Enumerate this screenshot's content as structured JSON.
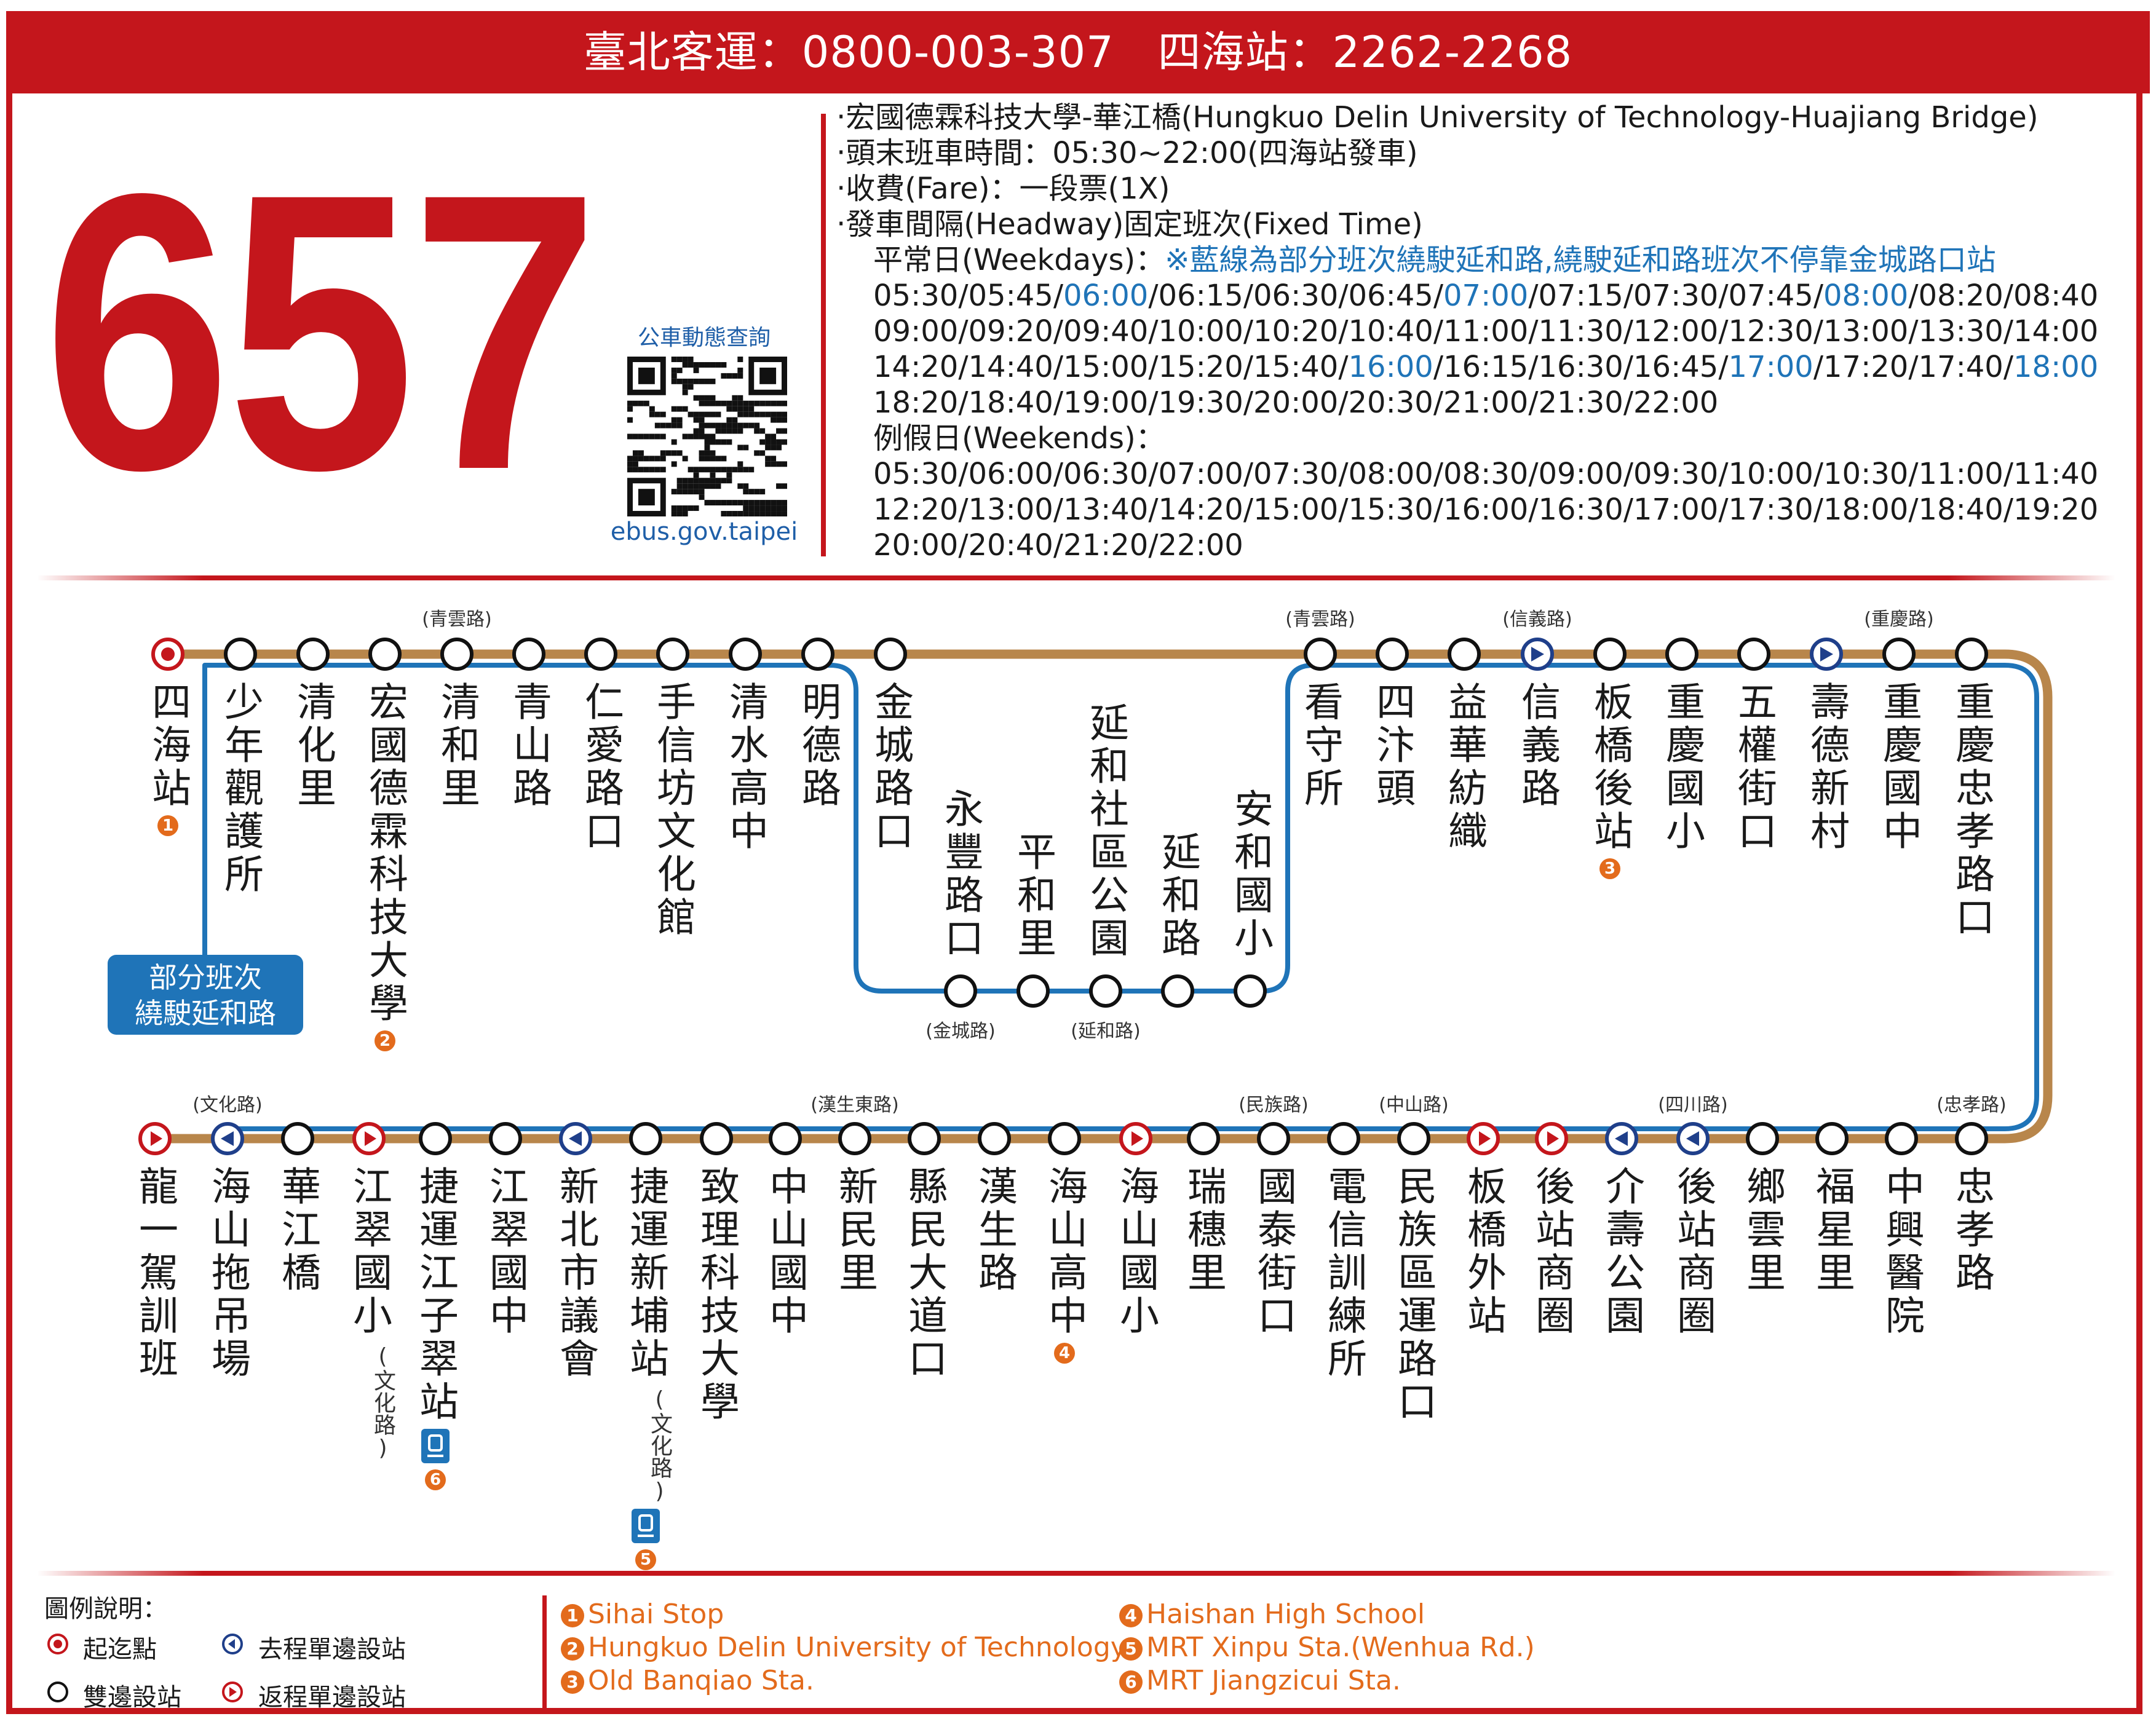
{
  "header": {
    "text": "臺北客運：0800-003-307　四海站：2262-2268"
  },
  "route": {
    "number": "657"
  },
  "qr": {
    "caption": "公車動態查詢",
    "url": "ebus.gov.taipei"
  },
  "info": {
    "line1": "‧宏國德霖科技大學-華江橋(Hungkuo Delin University of Technology-Huajiang Bridge)",
    "line2": "‧頭末班車時間：05:30~22:00(四海站發車)",
    "line3": "‧收費(Fare)：一段票(1X)",
    "line4": "‧發車間隔(Headway)固定班次(Fixed Time)",
    "weekday_label": "平常日(Weekdays)：",
    "weekday_note": "※藍線為部分班次繞駛延和路,繞駛延和路班次不停靠金城路口站",
    "weekday_times": [
      [
        [
          "05:30/05:45/",
          ""
        ],
        [
          "06:00",
          "blue"
        ],
        [
          "/06:15/06:30/06:45/",
          ""
        ],
        [
          "07:00",
          "blue"
        ],
        [
          "/07:15/07:30/07:45/",
          ""
        ],
        [
          "08:00",
          "blue"
        ],
        [
          "/08:20/08:40",
          ""
        ]
      ],
      [
        [
          "09:00/09:20/09:40/10:00/10:20/10:40/11:00/11:30/12:00/12:30/13:00/13:30/14:00",
          ""
        ]
      ],
      [
        [
          "14:20/14:40/15:00/15:20/15:40/",
          ""
        ],
        [
          "16:00",
          "blue"
        ],
        [
          "/16:15/16:30/16:45/",
          ""
        ],
        [
          "17:00",
          "blue"
        ],
        [
          "/17:20/17:40/",
          ""
        ],
        [
          "18:00",
          "blue"
        ]
      ],
      [
        [
          "18:20/18:40/19:00/19:30/20:00/20:30/21:00/21:30/22:00",
          ""
        ]
      ]
    ],
    "weekend_label": "例假日(Weekends)：",
    "weekend_times": [
      "05:30/06:00/06:30/07:00/07:30/08:00/08:30/09:00/09:30/10:00/10:30/11:00/11:40",
      "12:20/13:00/13:40/14:20/15:00/15:30/16:00/16:30/17:00/17:30/18:00/18:40/19:20",
      "20:00/20:40/21:20/22:00"
    ]
  },
  "colors": {
    "red": "#c4161c",
    "brown": "#b8864b",
    "blue": "#1f74b8",
    "orange": "#e36b1c"
  },
  "map": {
    "partial_note": "部分班次\n繞駛延和路",
    "top_stops": [
      {
        "name": "四海站",
        "type": "terminal",
        "badge": "1"
      },
      {
        "name": "少年觀護所",
        "type": "both"
      },
      {
        "name": "清化里",
        "type": "both"
      },
      {
        "name": "宏國德霖科技大學",
        "type": "both",
        "badge": "2"
      },
      {
        "name": "清和里",
        "type": "both",
        "road": "(青雲路)"
      },
      {
        "name": "青山路",
        "type": "both"
      },
      {
        "name": "仁愛路口",
        "type": "both"
      },
      {
        "name": "手信坊文化館",
        "type": "both"
      },
      {
        "name": "清水高中",
        "type": "both"
      },
      {
        "name": "明德路",
        "type": "both"
      },
      {
        "name": "金城路口",
        "type": "both"
      },
      {
        "name": "看守所",
        "type": "both",
        "road": "(青雲路)"
      },
      {
        "name": "四汴頭",
        "type": "both"
      },
      {
        "name": "益華紡織",
        "type": "both"
      },
      {
        "name": "信義路",
        "type": "outbound",
        "road": "(信義路)"
      },
      {
        "name": "板橋後站",
        "type": "both",
        "badge": "3"
      },
      {
        "name": "重慶國小",
        "type": "both"
      },
      {
        "name": "五權街口",
        "type": "both"
      },
      {
        "name": "壽德新村",
        "type": "outbound"
      },
      {
        "name": "重慶國中",
        "type": "both",
        "road": "(重慶路)"
      },
      {
        "name": "重慶忠孝路口",
        "type": "both"
      }
    ],
    "branch_stops": [
      {
        "name": "永豐路口",
        "type": "both",
        "road": "(金城路)"
      },
      {
        "name": "平和里",
        "type": "both"
      },
      {
        "name": "延和社區公園",
        "type": "both",
        "road": "(延和路)"
      },
      {
        "name": "延和路",
        "type": "both"
      },
      {
        "name": "安和國小",
        "type": "both"
      }
    ],
    "bottom_stops": [
      {
        "name": "龍一駕訓班",
        "type": "terminal_return"
      },
      {
        "name": "海山拖吊場",
        "type": "outbound",
        "road": "(文化路)"
      },
      {
        "name": "華江橋",
        "type": "both"
      },
      {
        "name": "江翠國小",
        "type": "return",
        "sub": "(文化路)"
      },
      {
        "name": "捷運江子翠站",
        "type": "both",
        "badge": "6",
        "metro": true
      },
      {
        "name": "江翠國中",
        "type": "both"
      },
      {
        "name": "新北市議會",
        "type": "outbound"
      },
      {
        "name": "捷運新埔站",
        "type": "both",
        "badge": "5",
        "metro": true,
        "sub": "(文化路)"
      },
      {
        "name": "致理科技大學",
        "type": "both"
      },
      {
        "name": "中山國中",
        "type": "both"
      },
      {
        "name": "新民里",
        "type": "both",
        "road": "(漢生東路)"
      },
      {
        "name": "縣民大道口",
        "type": "both"
      },
      {
        "name": "漢生路",
        "type": "both"
      },
      {
        "name": "海山高中",
        "type": "both",
        "badge": "4"
      },
      {
        "name": "海山國小",
        "type": "return"
      },
      {
        "name": "瑞穗里",
        "type": "both"
      },
      {
        "name": "國泰街口",
        "type": "both",
        "road": "(民族路)"
      },
      {
        "name": "電信訓練所",
        "type": "both"
      },
      {
        "name": "民族區運路口",
        "type": "both",
        "road": "(中山路)"
      },
      {
        "name": "板橋外站",
        "type": "return"
      },
      {
        "name": "後站商圈",
        "type": "return"
      },
      {
        "name": "介壽公園",
        "type": "outbound"
      },
      {
        "name": "後站商圈",
        "type": "outbound",
        "road": "(四川路)"
      },
      {
        "name": "鄉雲里",
        "type": "both"
      },
      {
        "name": "福星里",
        "type": "both"
      },
      {
        "name": "中興醫院",
        "type": "both"
      },
      {
        "name": "忠孝路",
        "type": "both",
        "road": "(忠孝路)"
      }
    ]
  },
  "legend": {
    "title": "圖例說明：",
    "items": [
      {
        "icon": "terminal-icon",
        "label": "起迄點"
      },
      {
        "icon": "outbound-icon",
        "label": "去程單邊設站"
      },
      {
        "icon": "both-icon",
        "label": "雙邊設站"
      },
      {
        "icon": "return-icon",
        "label": "返程單邊設站"
      }
    ]
  },
  "footnotes": [
    {
      "n": "1",
      "text": "Sihai Stop"
    },
    {
      "n": "2",
      "text": "Hungkuo Delin University of Technology"
    },
    {
      "n": "3",
      "text": "Old Banqiao Sta."
    },
    {
      "n": "4",
      "text": "Haishan High School"
    },
    {
      "n": "5",
      "text": "MRT Xinpu Sta.(Wenhua Rd.)"
    },
    {
      "n": "6",
      "text": "MRT Jiangzicui Sta."
    }
  ]
}
